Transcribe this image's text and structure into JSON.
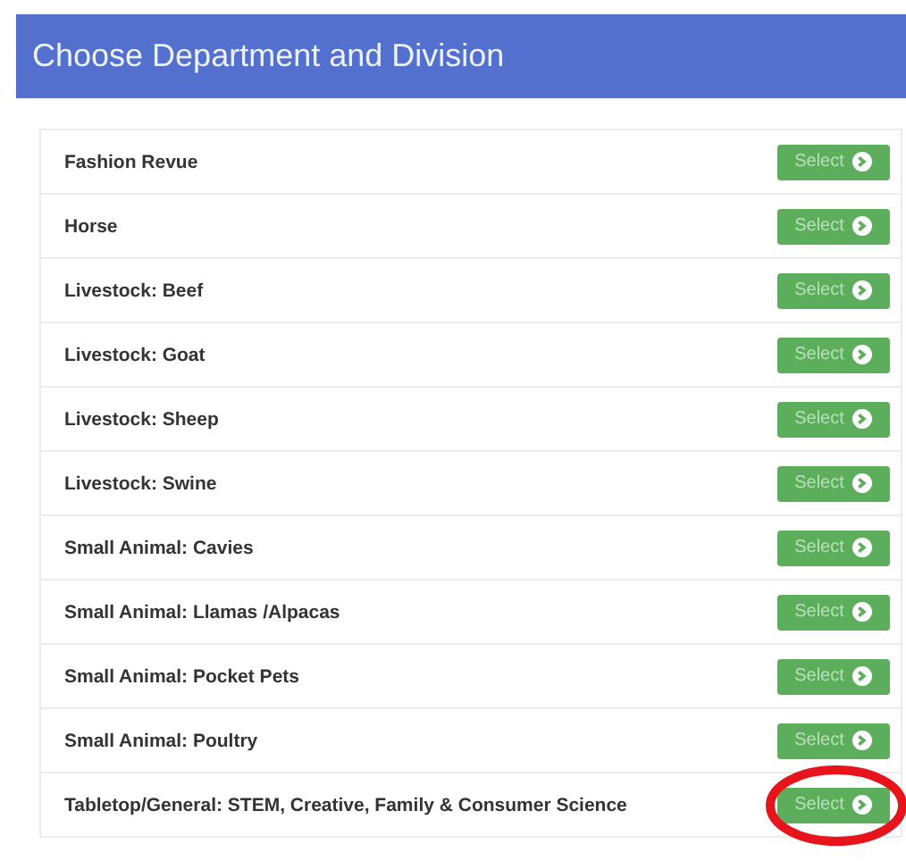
{
  "header": {
    "title": "Choose Department and Division"
  },
  "departments": [
    {
      "name": "Fashion Revue",
      "button": "Select"
    },
    {
      "name": "Horse",
      "button": "Select"
    },
    {
      "name": "Livestock: Beef",
      "button": "Select"
    },
    {
      "name": "Livestock: Goat",
      "button": "Select"
    },
    {
      "name": "Livestock: Sheep",
      "button": "Select"
    },
    {
      "name": "Livestock: Swine",
      "button": "Select"
    },
    {
      "name": "Small Animal: Cavies",
      "button": "Select"
    },
    {
      "name": "Small Animal: Llamas /Alpacas",
      "button": "Select"
    },
    {
      "name": "Small Animal: Pocket Pets",
      "button": "Select"
    },
    {
      "name": "Small Animal: Poultry",
      "button": "Select"
    },
    {
      "name": "Tabletop/General: STEM, Creative, Family & Consumer Science",
      "button": "Select",
      "circled": true
    }
  ]
}
